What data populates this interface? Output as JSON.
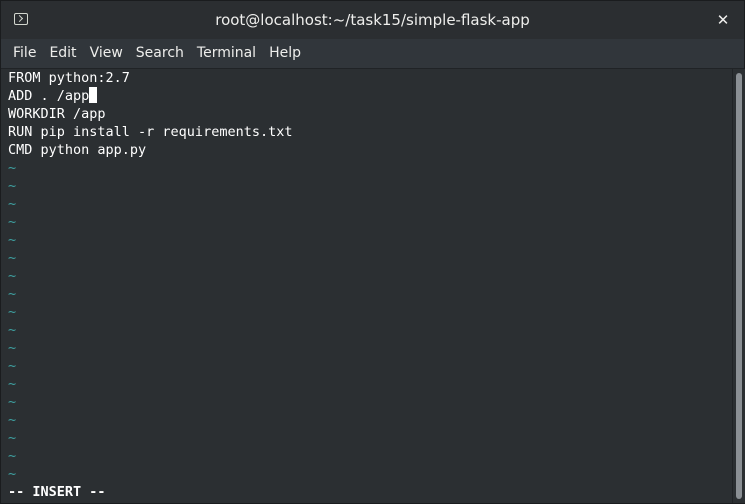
{
  "window": {
    "title": "root@localhost:~/task15/simple-flask-app",
    "icon": "terminal-icon",
    "close_label": "✕"
  },
  "menubar": {
    "items": [
      "File",
      "Edit",
      "View",
      "Search",
      "Terminal",
      "Help"
    ]
  },
  "editor": {
    "lines": [
      "FROM python:2.7",
      "ADD . /app",
      "WORKDIR /app",
      "RUN pip install -r requirements.txt",
      "CMD python app.py"
    ],
    "empty_line_marker": "~",
    "empty_line_count": 18,
    "cursor_line": 2,
    "status": "-- INSERT --"
  },
  "colors": {
    "background": "#2b2f32",
    "text": "#ffffff",
    "tilde": "#3ea0a0"
  }
}
